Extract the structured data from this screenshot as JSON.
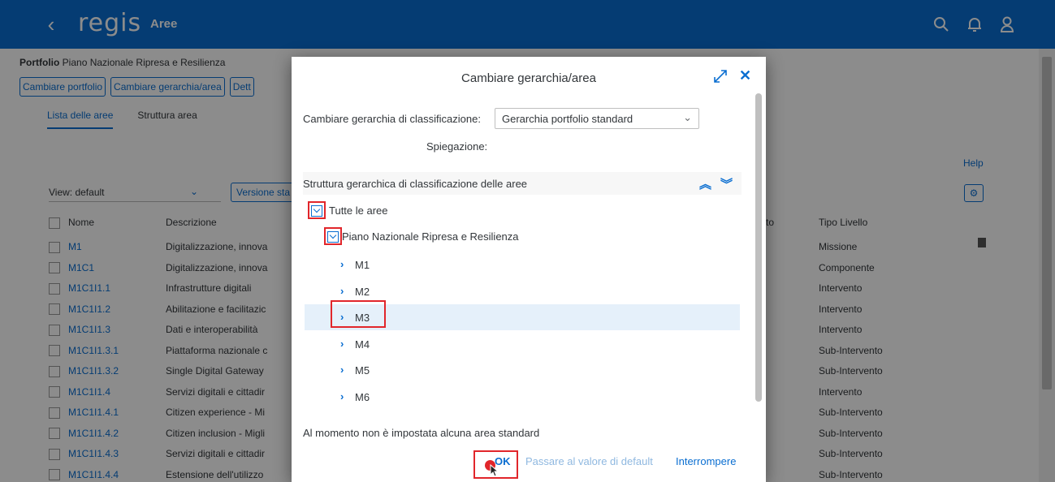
{
  "shell": {
    "back_icon": "chevron-left-icon",
    "logo": "regis",
    "title": "Aree",
    "icons": [
      "search-icon",
      "bell-icon",
      "user-icon"
    ]
  },
  "page": {
    "portfolio_label": "Portfolio",
    "portfolio_value": "Piano Nazionale Ripresa e Resilienza",
    "buttons": [
      "Cambiare portfolio",
      "Cambiare gerarchia/area",
      "Dett"
    ],
    "tabs": [
      "Lista delle aree",
      "Struttura area"
    ],
    "help": "Help",
    "view_label": "View: default",
    "versione": "Versione sta",
    "col_nome": "Nome",
    "col_descrizione": "Descrizione",
    "col_partial": "to",
    "col_tipo": "Tipo Livello",
    "rows": [
      {
        "id": "M1",
        "desc": "Digitalizzazione, innova",
        "tipo": "Missione"
      },
      {
        "id": "M1C1",
        "desc": "Digitalizzazione, innova",
        "tipo": "Componente"
      },
      {
        "id": "M1C1I1.1",
        "desc": "Infrastrutture digitali",
        "tipo": "Intervento"
      },
      {
        "id": "M1C1I1.2",
        "desc": "Abilitazione e facilitazic",
        "tipo": "Intervento"
      },
      {
        "id": "M1C1I1.3",
        "desc": "Dati e interoperabilità",
        "tipo": "Intervento"
      },
      {
        "id": "M1C1I1.3.1",
        "desc": "Piattaforma nazionale c",
        "tipo": "Sub-Intervento"
      },
      {
        "id": "M1C1I1.3.2",
        "desc": "Single Digital Gateway",
        "tipo": "Sub-Intervento"
      },
      {
        "id": "M1C1I1.4",
        "desc": "Servizi digitali e cittadir",
        "tipo": "Intervento"
      },
      {
        "id": "M1C1I1.4.1",
        "desc": "Citizen experience - Mi",
        "tipo": "Sub-Intervento"
      },
      {
        "id": "M1C1I1.4.2",
        "desc": "Citizen inclusion - Migli",
        "tipo": "Sub-Intervento"
      },
      {
        "id": "M1C1I1.4.3",
        "desc": "Servizi digitali e cittadir",
        "tipo": "Sub-Intervento"
      },
      {
        "id": "M1C1I1.4.4",
        "desc": "Estensione dell'utilizzo",
        "tipo": "Sub-Intervento"
      }
    ]
  },
  "dialog": {
    "title": "Cambiare gerarchia/area",
    "hier_label": "Cambiare gerarchia di classificazione:",
    "hier_value": "Gerarchia portfolio standard",
    "spiegazione": "Spiegazione:",
    "tree_header": "Struttura gerarchica di classificazione delle aree",
    "root": "Tutte le aree",
    "child": "Piano Nazionale Ripresa e Resilienza",
    "missions": [
      "M1",
      "M2",
      "M3",
      "M4",
      "M5",
      "M6"
    ],
    "footnote": "Al momento non è impostata alcuna area standard",
    "ok": "OK",
    "default": "Passare al valore di default",
    "cancel": "Interrompere"
  },
  "colors": {
    "shell": "#0a6ed1",
    "link": "#0a6ed1",
    "highlight": "#e1262b",
    "selected_row": "#e5f0fa"
  }
}
